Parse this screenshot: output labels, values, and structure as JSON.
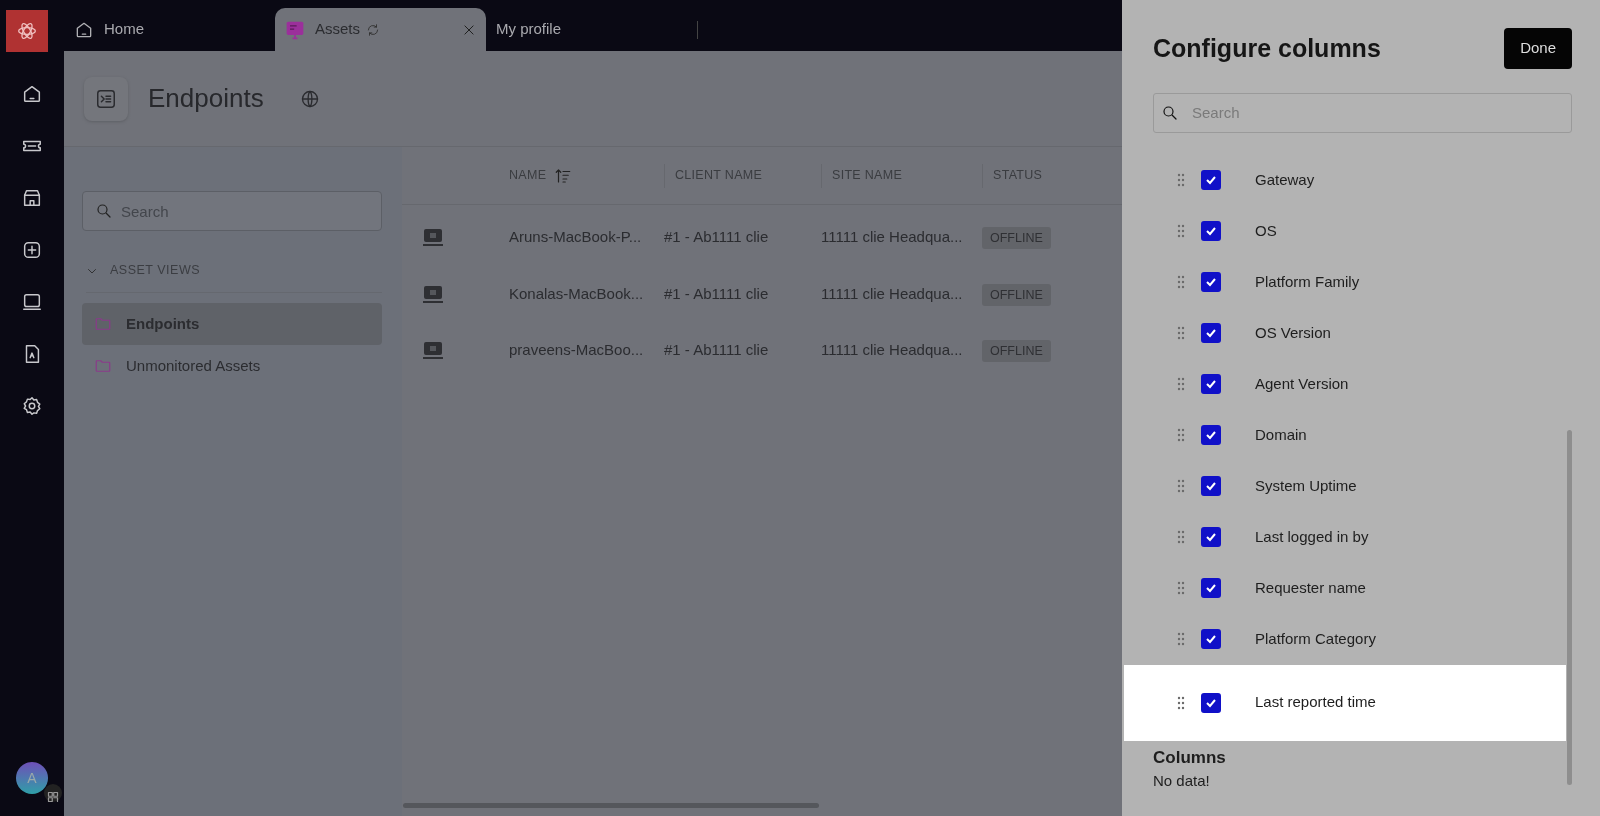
{
  "user": {
    "initial": "A"
  },
  "tabs": [
    {
      "label": "Home",
      "kind": "home",
      "selected": false,
      "loading": false,
      "closable": false
    },
    {
      "label": "Assets",
      "kind": "assets",
      "selected": true,
      "loading": true,
      "closable": true
    },
    {
      "label": "My profile",
      "kind": "plain",
      "selected": false,
      "loading": false,
      "closable": false
    }
  ],
  "page": {
    "title": "Endpoints"
  },
  "sidebar": {
    "search": {
      "placeholder": "Search"
    },
    "section": {
      "label": "ASSET VIEWS",
      "expanded": true
    },
    "items": [
      {
        "label": "Endpoints",
        "selected": true
      },
      {
        "label": "Unmonitored Assets",
        "selected": false
      }
    ]
  },
  "table": {
    "columns": [
      {
        "label": "NAME",
        "sorted": true
      },
      {
        "label": "CLIENT NAME",
        "sorted": false
      },
      {
        "label": "SITE NAME",
        "sorted": false
      },
      {
        "label": "STATUS",
        "sorted": false
      }
    ],
    "rows": [
      {
        "name": "Aruns-MacBook-P...",
        "client": "#1 - Ab1111 clie",
        "site": "11111 clie Headqua...",
        "status": "OFFLINE"
      },
      {
        "name": "Konalas-MacBook...",
        "client": "#1 - Ab1111 clie",
        "site": "11111 clie Headqua...",
        "status": "OFFLINE"
      },
      {
        "name": "praveens-MacBoo...",
        "client": "#1 - Ab1111 clie",
        "site": "11111 clie Headqua...",
        "status": "OFFLINE"
      }
    ]
  },
  "panel": {
    "title": "Configure columns",
    "done": "Done",
    "search": {
      "placeholder": "Search"
    },
    "items": [
      {
        "label": "Gateway",
        "checked": true,
        "highlighted": false
      },
      {
        "label": "OS",
        "checked": true,
        "highlighted": false
      },
      {
        "label": "Platform Family",
        "checked": true,
        "highlighted": false
      },
      {
        "label": "OS Version",
        "checked": true,
        "highlighted": false
      },
      {
        "label": "Agent Version",
        "checked": true,
        "highlighted": false
      },
      {
        "label": "Domain",
        "checked": true,
        "highlighted": false
      },
      {
        "label": "System Uptime",
        "checked": true,
        "highlighted": false
      },
      {
        "label": "Last logged in by",
        "checked": true,
        "highlighted": false
      },
      {
        "label": "Requester name",
        "checked": true,
        "highlighted": false
      },
      {
        "label": "Platform Category",
        "checked": true,
        "highlighted": false
      },
      {
        "label": "Last reported time",
        "checked": true,
        "highlighted": true
      }
    ],
    "empty": {
      "title": "Columns",
      "message": "No data!"
    }
  }
}
